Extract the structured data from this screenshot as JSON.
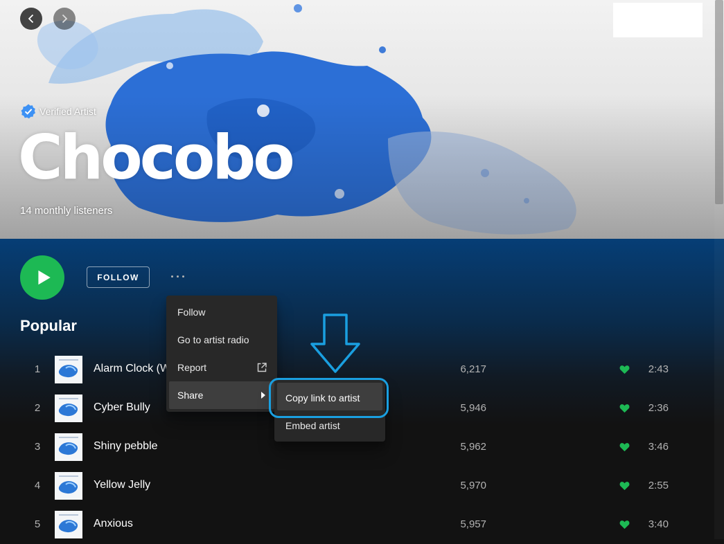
{
  "nav": {
    "back_label": "Go back",
    "forward_label": "Go forward"
  },
  "artist": {
    "verified_label": "Verified Artist",
    "name": "Chocobo",
    "monthly_listeners": "14 monthly listeners"
  },
  "actions": {
    "follow_label": "FOLLOW"
  },
  "popular": {
    "title": "Popular",
    "tracks": [
      {
        "num": "1",
        "title": "Alarm Clock (W",
        "plays": "6,217",
        "duration": "2:43"
      },
      {
        "num": "2",
        "title": "Cyber Bully",
        "plays": "5,946",
        "duration": "2:36"
      },
      {
        "num": "3",
        "title": "Shiny pebble",
        "plays": "5,962",
        "duration": "3:46"
      },
      {
        "num": "4",
        "title": "Yellow Jelly",
        "plays": "5,970",
        "duration": "2:55"
      },
      {
        "num": "5",
        "title": "Anxious",
        "plays": "5,957",
        "duration": "3:40"
      }
    ]
  },
  "context_menu": {
    "items": [
      {
        "label": "Follow"
      },
      {
        "label": "Go to artist radio"
      },
      {
        "label": "Report"
      },
      {
        "label": "Share"
      }
    ],
    "share_submenu": [
      {
        "label": "Copy link to artist"
      },
      {
        "label": "Embed artist"
      }
    ]
  },
  "colors": {
    "accent_green": "#1db954",
    "menu_bg": "#282828",
    "menu_active": "#3e3e3e",
    "annotation_blue": "#1a9fe0",
    "hero_blue": "#2c6fd6"
  },
  "icons": [
    "chevron-left-icon",
    "chevron-right-icon",
    "verified-badge-icon",
    "play-icon",
    "more-dots-icon",
    "external-link-icon",
    "caret-right-icon",
    "heart-icon",
    "down-arrow-annotation"
  ]
}
